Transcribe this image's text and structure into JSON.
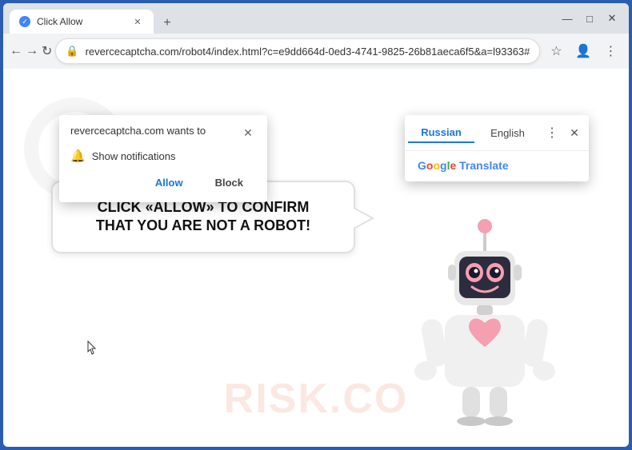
{
  "browser": {
    "tab": {
      "title": "Click Allow",
      "favicon_label": "check-icon"
    },
    "new_tab_label": "+",
    "window_controls": {
      "minimize": "—",
      "maximize": "□",
      "close": "✕"
    },
    "nav": {
      "back_label": "←",
      "forward_label": "→",
      "reload_label": "↻",
      "url": "revercecaptcha.com/robot4/index.html?c=e9dd664d-0ed3-4741-9825-26b81aeca6f5&a=l93363#",
      "star_label": "☆",
      "account_label": "👤",
      "more_label": "⋮"
    }
  },
  "notification_popup": {
    "title": "revercecaptcha.com wants to",
    "close_label": "✕",
    "item_text": "Show notifications",
    "allow_label": "Allow",
    "block_label": "Block"
  },
  "translate_popup": {
    "tab_russian": "Russian",
    "tab_english": "English",
    "more_label": "⋮",
    "close_label": "✕",
    "service_prefix": "Google ",
    "service_name": "Translate"
  },
  "page": {
    "message": "CLICK «ALLOW» TO CONFIRM THAT YOU ARE NOT A ROBOT!",
    "watermark": "RISK.CO"
  }
}
